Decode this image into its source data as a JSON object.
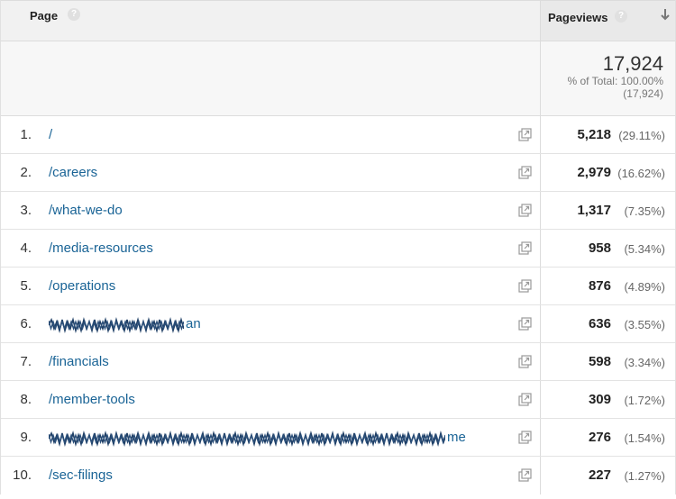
{
  "header": {
    "page_label": "Page",
    "pageviews_label": "Pageviews",
    "help_glyph": "?"
  },
  "totals": {
    "value": "17,924",
    "pct_line": "% of Total: 100.00%",
    "abs_line": "(17,924)"
  },
  "rows": [
    {
      "idx": "1.",
      "path": "/",
      "pageviews": "5,218",
      "pct": "(29.11%)"
    },
    {
      "idx": "2.",
      "path": "/careers",
      "pageviews": "2,979",
      "pct": "(16.62%)"
    },
    {
      "idx": "3.",
      "path": "/what-we-do",
      "pageviews": "1,317",
      "pct": "(7.35%)"
    },
    {
      "idx": "4.",
      "path": "/media-resources",
      "pageviews": "958",
      "pct": "(5.34%)"
    },
    {
      "idx": "5.",
      "path": "/operations",
      "pageviews": "876",
      "pct": "(4.89%)"
    },
    {
      "idx": "6.",
      "path": "an",
      "pageviews": "636",
      "pct": "(3.55%)"
    },
    {
      "idx": "7.",
      "path": "/financials",
      "pageviews": "598",
      "pct": "(3.34%)"
    },
    {
      "idx": "8.",
      "path": "/member-tools",
      "pageviews": "309",
      "pct": "(1.72%)"
    },
    {
      "idx": "9.",
      "path": "me",
      "pageviews": "276",
      "pct": "(1.54%)"
    },
    {
      "idx": "10.",
      "path": "/sec-filings",
      "pageviews": "227",
      "pct": "(1.27%)"
    }
  ],
  "colors": {
    "link": "#1a6496",
    "header_bg": "#f1f1f1",
    "totals_bg": "#f7f7f7"
  }
}
